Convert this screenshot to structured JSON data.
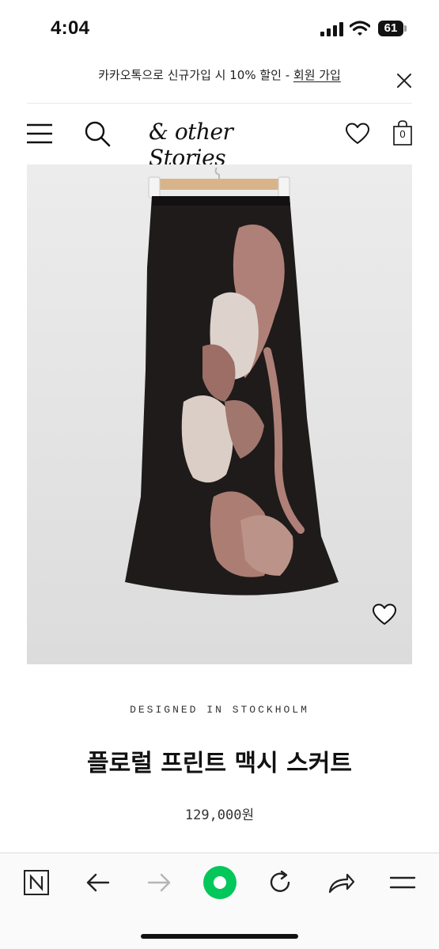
{
  "status_bar": {
    "time": "4:04",
    "battery": "61"
  },
  "promo": {
    "text": "카카오톡으로 신규가입 시 10% 할인 - ",
    "link": "회원 가입"
  },
  "header": {
    "brand": "& other Stories",
    "bag_count": "0"
  },
  "product": {
    "tagline": "DESIGNED IN STOCKHOLM",
    "title": "플로럴 프린트 맥시 스커트",
    "price": "129,000원"
  },
  "browser_toolbar": {
    "items": [
      "naver-icon",
      "back-icon",
      "forward-icon",
      "green-dot-icon",
      "refresh-icon",
      "share-icon",
      "menu-icon"
    ]
  },
  "colors": {
    "accent_green": "#03c75a",
    "skirt": "#1e1b1a",
    "petal": "#b7867c"
  }
}
